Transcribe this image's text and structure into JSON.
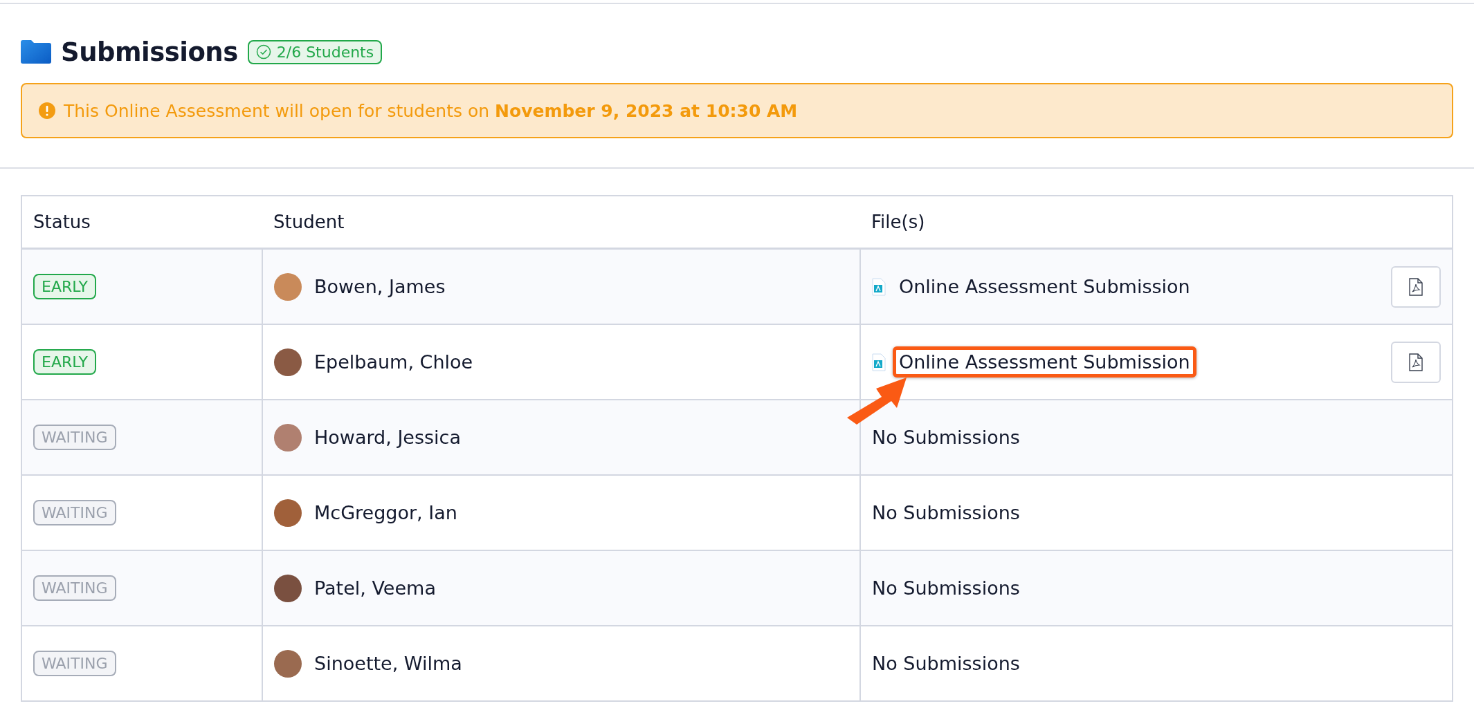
{
  "title": "Submissions",
  "badge": "2/6 Students",
  "notice": "This Online Assessment will open for students on **November 9, 2023 at 10:30 AM**",
  "table": {
    "columns": [
      "Status",
      "Student",
      "File(s)"
    ],
    "rows": [
      {
        "status": {
          "label": "EARLY",
          "kind": "early"
        },
        "student": "Bowen, James",
        "file": {
          "kind": "file",
          "name": "Online Assessment Submission",
          "highlighted": false
        }
      },
      {
        "status": {
          "label": "EARLY",
          "kind": "early"
        },
        "student": "Epelbaum, Chloe",
        "file": {
          "kind": "file",
          "name": "Online Assessment Submission",
          "highlighted": true
        }
      },
      {
        "status": {
          "label": "WAITING",
          "kind": "waiting"
        },
        "student": "Howard, Jessica",
        "file": {
          "kind": "none",
          "text": "No Submissions"
        }
      },
      {
        "status": {
          "label": "WAITING",
          "kind": "waiting"
        },
        "student": "McGreggor, Ian",
        "file": {
          "kind": "none",
          "text": "No Submissions"
        }
      },
      {
        "status": {
          "label": "WAITING",
          "kind": "waiting"
        },
        "student": "Patel, Veema",
        "file": {
          "kind": "none",
          "text": "No Submissions"
        }
      },
      {
        "status": {
          "label": "WAITING",
          "kind": "waiting"
        },
        "student": "Sinoette, Wilma",
        "file": {
          "kind": "none",
          "text": "No Submissions"
        }
      }
    ]
  }
}
